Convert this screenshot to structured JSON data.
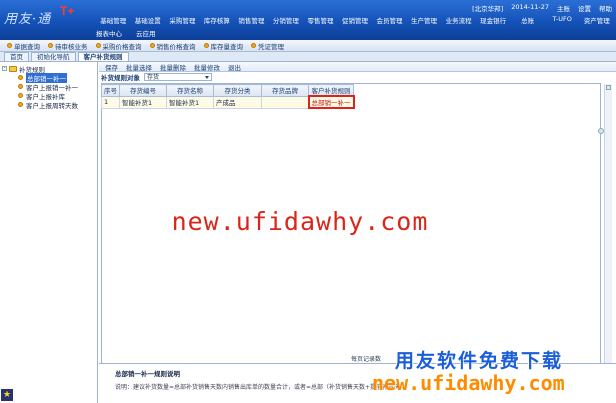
{
  "app": {
    "logo": "用友·通",
    "logo_mark": "T+"
  },
  "status": {
    "company": "[北京华邦]",
    "date": "2014-11-27",
    "user": "主账",
    "settings": "设置",
    "help": "帮助"
  },
  "menu": [
    "基础管理",
    "基础设置",
    "采购管理",
    "库存核算",
    "销售管理",
    "分销管理",
    "零售管理",
    "促销管理",
    "会员管理",
    "生产管理",
    "业务流程",
    "现金银行",
    "总账",
    "T-UFO",
    "资产管理"
  ],
  "menu2": [
    "报表中心",
    "云应用"
  ],
  "toolbar": [
    "单据查询",
    "待审核业务",
    "采购价格查询",
    "销售价格查询",
    "库存量查询",
    "凭证管理"
  ],
  "tabs": [
    "首页",
    "初始化导航",
    "客户补货规则"
  ],
  "tree": {
    "root": "补货规则",
    "nodes": [
      "总部销一补一",
      "客户上报销一补一",
      "客户上报补库",
      "客户上报周转天数"
    ]
  },
  "subtool": [
    "保存",
    "批量选择",
    "批量删除",
    "批量修改",
    "退出"
  ],
  "filter": {
    "label": "补货规则对象",
    "value": "存货"
  },
  "grid": {
    "headers": [
      "序号",
      "存货编号",
      "存货名称",
      "存货分类",
      "存货品牌",
      "客户补货规则"
    ],
    "rows": [
      [
        "1",
        "智能补货1",
        "智能补货1",
        "产成品",
        "",
        "总部销一补一"
      ]
    ]
  },
  "pager": {
    "text": "每页记录数"
  },
  "description": {
    "title": "总部销一补一规则说明",
    "body": "说明：建议补货数量=总部补货销售天数内销售出库单的数量合计，或者=总部（补货销售天数+提前补货天数）"
  },
  "watermarks": {
    "main": "new.ufidawhy.com",
    "brand": "用友软件免费下载",
    "url": "new.ufidawhy.com"
  }
}
